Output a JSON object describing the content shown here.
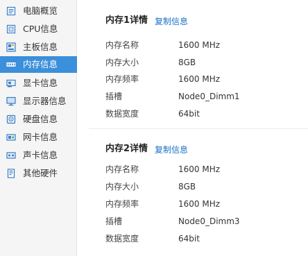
{
  "sidebar": {
    "items": [
      {
        "label": "电脑概览",
        "icon": "monitor-doc-icon"
      },
      {
        "label": "CPU信息",
        "icon": "cpu-icon"
      },
      {
        "label": "主板信息",
        "icon": "motherboard-icon"
      },
      {
        "label": "内存信息",
        "icon": "memory-icon",
        "active": true
      },
      {
        "label": "显卡信息",
        "icon": "graphics-card-icon"
      },
      {
        "label": "显示器信息",
        "icon": "display-icon"
      },
      {
        "label": "硬盘信息",
        "icon": "hard-disk-icon"
      },
      {
        "label": "网卡信息",
        "icon": "network-card-icon"
      },
      {
        "label": "声卡信息",
        "icon": "sound-card-icon"
      },
      {
        "label": "其他硬件",
        "icon": "other-hardware-icon"
      }
    ]
  },
  "sections": [
    {
      "title": "内存1详情",
      "copy_label": "复制信息",
      "rows": [
        {
          "k": "内存名称",
          "v": "1600 MHz"
        },
        {
          "k": "内存大小",
          "v": "8GB"
        },
        {
          "k": "内存频率",
          "v": "1600 MHz"
        },
        {
          "k": "插槽",
          "v": "Node0_Dimm1"
        },
        {
          "k": "数据宽度",
          "v": "64bit"
        }
      ]
    },
    {
      "title": "内存2详情",
      "copy_label": "复制信息",
      "rows": [
        {
          "k": "内存名称",
          "v": "1600 MHz"
        },
        {
          "k": "内存大小",
          "v": "8GB"
        },
        {
          "k": "内存频率",
          "v": "1600 MHz"
        },
        {
          "k": "插槽",
          "v": "Node0_Dimm3"
        },
        {
          "k": "数据宽度",
          "v": "64bit"
        }
      ]
    }
  ],
  "colors": {
    "accent": "#3c8fda",
    "link": "#1a6fc9",
    "sidebar_bg": "#f5f5f5"
  }
}
